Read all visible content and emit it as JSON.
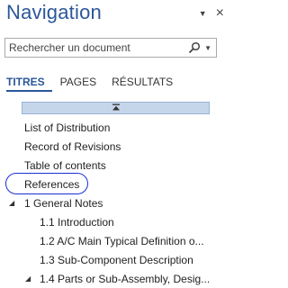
{
  "pane": {
    "title": "Navigation",
    "dropdown_icon": "chevron-down-icon",
    "close_label": "×"
  },
  "search": {
    "placeholder": "Rechercher un document",
    "value": "",
    "icon": "magnifier-icon",
    "dropdown_icon": "chevron-down-icon"
  },
  "tabs": [
    {
      "label": "TITRES",
      "active": true
    },
    {
      "label": "PAGES",
      "active": false
    },
    {
      "label": "RÉSULTATS",
      "active": false
    }
  ],
  "collapse_all_icon": "collapse-all-icon",
  "headings": [
    {
      "label": "List of Distribution"
    },
    {
      "label": "Record of Revisions"
    },
    {
      "label": "Table of contents"
    },
    {
      "label": "References",
      "highlighted": true
    },
    {
      "label": "1 General Notes",
      "expanded": true
    },
    {
      "label": "1.1 Introduction"
    },
    {
      "label": "1.2 A/C Main Typical Definition o..."
    },
    {
      "label": "1.3 Sub-Component Description"
    },
    {
      "label": "1.4 Parts or Sub-Assembly, Desig...",
      "expanded": true
    }
  ],
  "colors": {
    "accent": "#2b579a",
    "collapse_bar": "#c5d5ea",
    "annotation_circle": "#1a2fd6"
  }
}
